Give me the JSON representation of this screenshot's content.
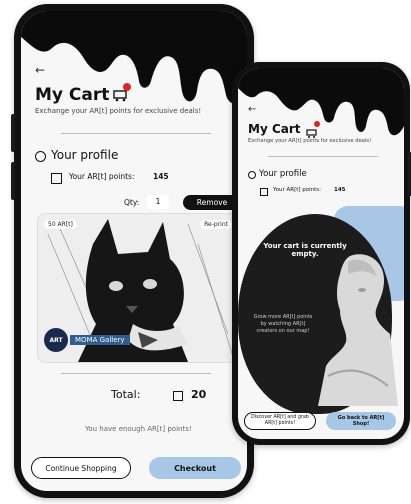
{
  "colors": {
    "accent": "#a8c7e6",
    "dark": "#111111",
    "badge": "#e02424",
    "bg": "#f7f7f7"
  },
  "left": {
    "cart": {
      "title": "My Cart",
      "subtitle": "Exchange your AR[t] points for exclusive deals!",
      "badge_icon": "shopping-cart-icon"
    },
    "profile": {
      "heading": "Your profile",
      "points_label": "Your AR[t] points:",
      "points_value": "145"
    },
    "item": {
      "qty_label": "Qty:",
      "qty_value": "1",
      "remove_label": "Remove",
      "tag_left": "50 AR[t]",
      "tag_right": "Re-print",
      "brand": "MOMA Gallery",
      "logo_text": "ART"
    },
    "summary": {
      "total_label": "Total:",
      "total_value": "20",
      "message": "You have enough AR[t] points!"
    },
    "buttons": {
      "continue": "Continue Shopping",
      "checkout": "Checkout"
    }
  },
  "right": {
    "cart": {
      "title": "My Cart",
      "subtitle": "Exchange your AR[t] points for exclusive deals!"
    },
    "profile": {
      "heading": "Your profile",
      "points_label": "Your AR[t] points:",
      "points_value": "145"
    },
    "empty": {
      "heading": "Your cart is currently empty.",
      "hint": "Grow more AR[t] points by watching AR[t] creators on our map!"
    },
    "buttons": {
      "discover": "Discover AR[t] and grab AR[t] points!",
      "back": "Go back to AR[t] Shop!"
    }
  }
}
